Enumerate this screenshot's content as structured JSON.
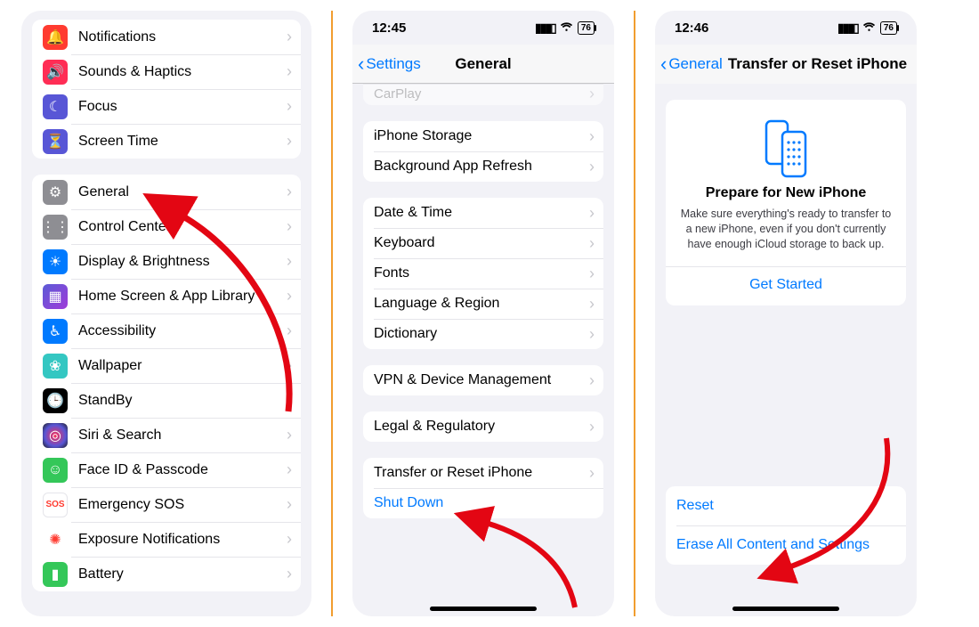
{
  "statusbar": {
    "time2": "12:45",
    "time3": "12:46",
    "battery": "76"
  },
  "phone1": {
    "group1": [
      {
        "icon": "bell-icon",
        "bg": "#ff3b30",
        "glyph": "🔔",
        "label": "Notifications"
      },
      {
        "icon": "speaker-icon",
        "bg": "#ff2d55",
        "glyph": "🔊",
        "label": "Sounds & Haptics"
      },
      {
        "icon": "moon-icon",
        "bg": "#5856d6",
        "glyph": "☾",
        "label": "Focus"
      },
      {
        "icon": "hourglass-icon",
        "bg": "#5856d6",
        "glyph": "⏳",
        "label": "Screen Time"
      }
    ],
    "group2": [
      {
        "icon": "gear-icon",
        "bg": "#8e8e93",
        "glyph": "⚙",
        "label": "General"
      },
      {
        "icon": "switches-icon",
        "bg": "#8e8e93",
        "glyph": "⋮⋮",
        "label": "Control Center"
      },
      {
        "icon": "brightness-icon",
        "bg": "#007aff",
        "glyph": "☀",
        "label": "Display & Brightness"
      },
      {
        "icon": "homescreen-icon",
        "bg": "#3a3a9f",
        "glyph": "▦",
        "label": "Home Screen & App Library"
      },
      {
        "icon": "accessibility-icon",
        "bg": "#007aff",
        "glyph": "♿︎",
        "label": "Accessibility"
      },
      {
        "icon": "wallpaper-icon",
        "bg": "#34c7c2",
        "glyph": "❀",
        "label": "Wallpaper"
      },
      {
        "icon": "standby-icon",
        "bg": "#000000",
        "glyph": "🕒",
        "label": "StandBy"
      },
      {
        "icon": "siri-icon",
        "bg": "#1c1c1e",
        "glyph": "◎",
        "label": "Siri & Search"
      },
      {
        "icon": "faceid-icon",
        "bg": "#34c759",
        "glyph": "☺",
        "label": "Face ID & Passcode"
      },
      {
        "icon": "sos-icon",
        "bg": "#ffffff",
        "glyph": "SOS",
        "label": "Emergency SOS",
        "text": "#ff3b30",
        "border": true
      },
      {
        "icon": "exposure-icon",
        "bg": "#ffffff",
        "glyph": "✺",
        "label": "Exposure Notifications",
        "text": "#ff3b30"
      },
      {
        "icon": "battery-icon",
        "bg": "#34c759",
        "glyph": "▮",
        "label": "Battery"
      }
    ]
  },
  "phone2": {
    "back": "Settings",
    "title": "General",
    "partial": {
      "label": "CarPlay"
    },
    "g1": [
      {
        "label": "iPhone Storage"
      },
      {
        "label": "Background App Refresh"
      }
    ],
    "g2": [
      {
        "label": "Date & Time"
      },
      {
        "label": "Keyboard"
      },
      {
        "label": "Fonts"
      },
      {
        "label": "Language & Region"
      },
      {
        "label": "Dictionary"
      }
    ],
    "g3": [
      {
        "label": "VPN & Device Management"
      }
    ],
    "g4": [
      {
        "label": "Legal & Regulatory"
      }
    ],
    "g5": [
      {
        "label": "Transfer or Reset iPhone"
      },
      {
        "label": "Shut Down",
        "link": true,
        "noChev": true
      }
    ]
  },
  "phone3": {
    "back": "General",
    "title": "Transfer or Reset iPhone",
    "card": {
      "heading": "Prepare for New iPhone",
      "body": "Make sure everything's ready to transfer to a new iPhone, even if you don't currently have enough iCloud storage to back up.",
      "cta": "Get Started"
    },
    "bottom": [
      {
        "label": "Reset",
        "link": true,
        "noChev": true
      },
      {
        "label": "Erase All Content and Settings",
        "link": true,
        "noChev": true
      }
    ]
  }
}
